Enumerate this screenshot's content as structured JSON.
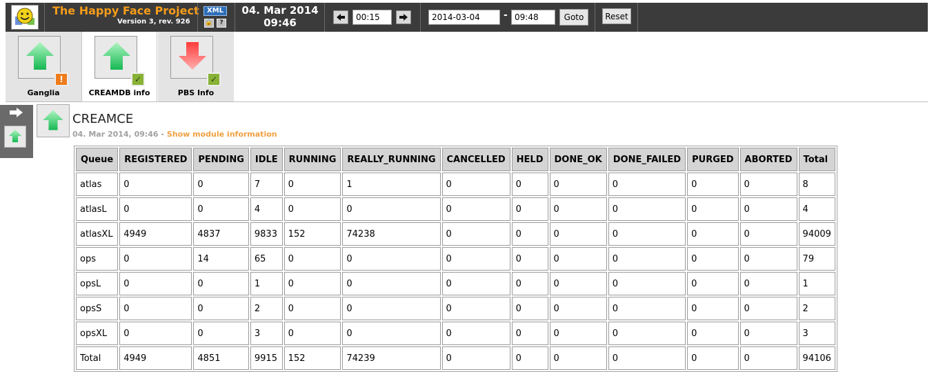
{
  "header": {
    "title": "The Happy Face Project",
    "version": "Version 3, rev. 926",
    "xml_label": "XML",
    "lock_glyph": "🔒",
    "help_glyph": "?",
    "date_line": "04. Mar 2014",
    "time_line": "09:46",
    "step_value": "00:15",
    "goto_date": "2014-03-04",
    "dash": "-",
    "goto_time": "09:48",
    "goto_label": "Goto",
    "reset_label": "Reset"
  },
  "categories": [
    {
      "label": "Ganglia",
      "arrow": "up",
      "status": "warning",
      "badge": "!"
    },
    {
      "label": "CREAMDB info",
      "arrow": "up",
      "status": "ok",
      "badge": "✓"
    },
    {
      "label": "PBS Info",
      "arrow": "down",
      "status": "ok",
      "badge": "✓"
    }
  ],
  "colors": {
    "accent": "#f59c1a",
    "topbar": "#3b3b3b",
    "arrow_up": "#2fcc6a",
    "arrow_down": "#ee2a33",
    "warning": "#ef7c1c",
    "ok": "#88b236"
  },
  "module": {
    "title": "CREAMCE",
    "timestamp": "04. Mar 2014, 09:46",
    "sep": "-",
    "info_link": "Show module information"
  },
  "table": {
    "headers": [
      "Queue",
      "REGISTERED",
      "PENDING",
      "IDLE",
      "RUNNING",
      "REALLY_RUNNING",
      "CANCELLED",
      "HELD",
      "DONE_OK",
      "DONE_FAILED",
      "PURGED",
      "ABORTED",
      "Total"
    ],
    "rows": [
      [
        "atlas",
        "0",
        "0",
        "7",
        "0",
        "1",
        "0",
        "0",
        "0",
        "0",
        "0",
        "0",
        "8"
      ],
      [
        "atlasL",
        "0",
        "0",
        "4",
        "0",
        "0",
        "0",
        "0",
        "0",
        "0",
        "0",
        "0",
        "4"
      ],
      [
        "atlasXL",
        "4949",
        "4837",
        "9833",
        "152",
        "74238",
        "0",
        "0",
        "0",
        "0",
        "0",
        "0",
        "94009"
      ],
      [
        "ops",
        "0",
        "14",
        "65",
        "0",
        "0",
        "0",
        "0",
        "0",
        "0",
        "0",
        "0",
        "79"
      ],
      [
        "opsL",
        "0",
        "0",
        "1",
        "0",
        "0",
        "0",
        "0",
        "0",
        "0",
        "0",
        "0",
        "1"
      ],
      [
        "opsS",
        "0",
        "0",
        "2",
        "0",
        "0",
        "0",
        "0",
        "0",
        "0",
        "0",
        "0",
        "2"
      ],
      [
        "opsXL",
        "0",
        "0",
        "3",
        "0",
        "0",
        "0",
        "0",
        "0",
        "0",
        "0",
        "0",
        "3"
      ],
      [
        "Total",
        "4949",
        "4851",
        "9915",
        "152",
        "74239",
        "0",
        "0",
        "0",
        "0",
        "0",
        "0",
        "94106"
      ]
    ]
  }
}
